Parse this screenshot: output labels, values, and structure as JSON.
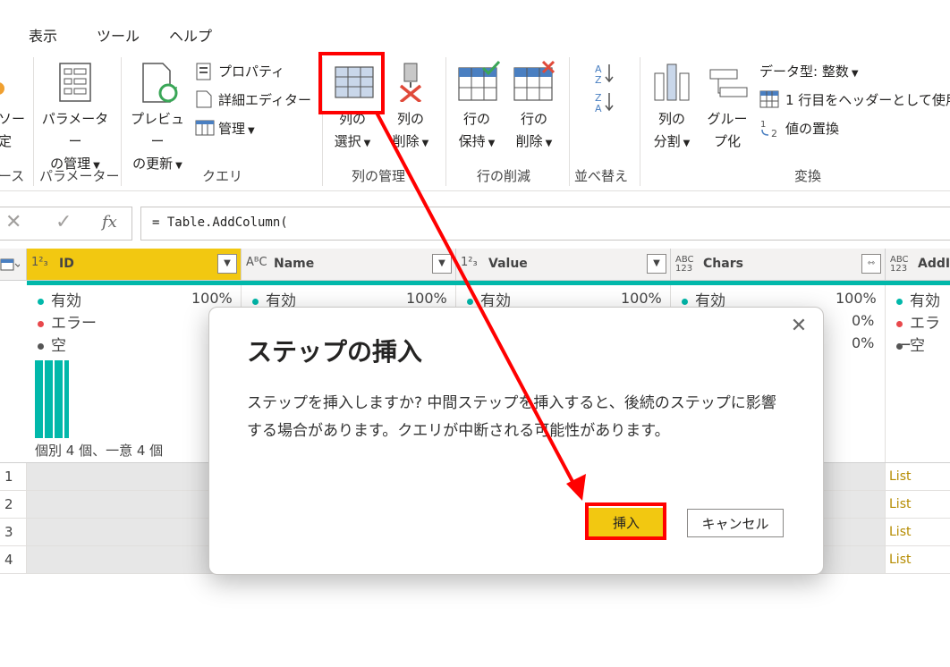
{
  "menu": {
    "view": "表示",
    "tools": "ツール",
    "help": "ヘルプ"
  },
  "ribbon": {
    "partial_left": {
      "line1": "ソー",
      "line2": "定",
      "group": "ース"
    },
    "parameters": {
      "btn_line1": "パラメーター",
      "btn_line2": "の管理",
      "group": "パラメーター"
    },
    "query": {
      "preview_line1": "プレビュー",
      "preview_line2": "の更新",
      "properties": "プロパティ",
      "advanced_editor": "詳細エディター",
      "manage": "管理",
      "group": "クエリ"
    },
    "manage_columns": {
      "choose_line1": "列の",
      "choose_line2": "選択",
      "remove_line1": "列の",
      "remove_line2": "削除",
      "group": "列の管理"
    },
    "reduce_rows": {
      "keep_line1": "行の",
      "keep_line2": "保持",
      "remove_line1": "行の",
      "remove_line2": "削除",
      "group": "行の削減"
    },
    "sort": {
      "group": "並べ替え"
    },
    "transform": {
      "split_line1": "列の",
      "split_line2": "分割",
      "group_by_line1": "グルー",
      "group_by_line2": "プ化",
      "data_type": "データ型: 整数",
      "first_row_header": "1 行目をヘッダーとして使用",
      "replace_values": "値の置換",
      "group": "変換"
    }
  },
  "formula": {
    "text": "= Table.AddColumn(",
    "fx": "fx"
  },
  "grid": {
    "columns": [
      {
        "type": "1²₃",
        "name": "ID"
      },
      {
        "type": "AᴮC",
        "name": "Name"
      },
      {
        "type": "1²₃",
        "name": "Value"
      },
      {
        "type": "ABC 123",
        "name": "Chars"
      },
      {
        "type": "ABC 123",
        "name": "AddI"
      }
    ],
    "profile": {
      "valid": "有効",
      "error": "エラー",
      "empty": "空",
      "pct_100": "100%",
      "pct_0": "0%",
      "distinct": "個別 4 個、一意 4 個"
    },
    "row_numbers": [
      "1",
      "2",
      "3",
      "4"
    ],
    "list_cell": "List"
  },
  "dialog": {
    "title": "ステップの挿入",
    "close": "✕",
    "body": "ステップを挿入しますか? 中間ステップを挿入すると、後続のステップに影響する場合があります。クエリが中断される可能性があります。",
    "insert": "挿入",
    "cancel": "キャンセル"
  },
  "colors": {
    "accent_yellow": "#f2c811",
    "teal": "#01b8aa",
    "error_red": "#e8484c",
    "annotation_red": "#ff0000",
    "list_link": "#b58b00"
  }
}
